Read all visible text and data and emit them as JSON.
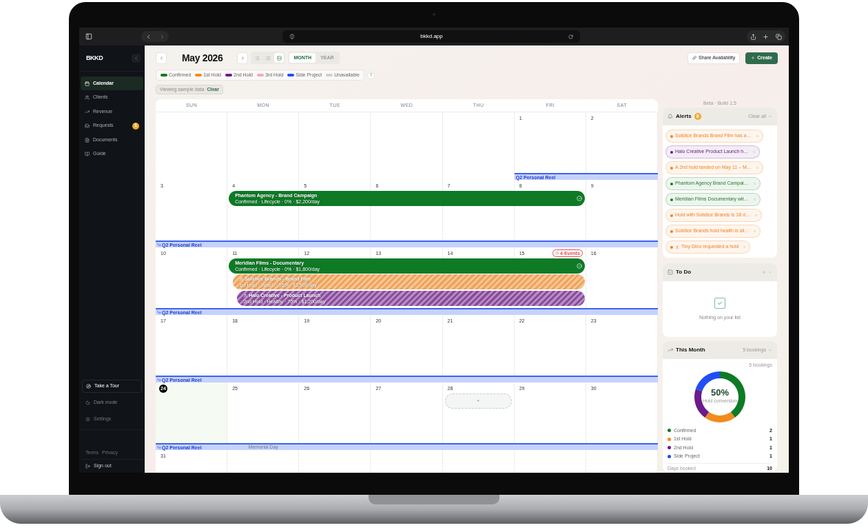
{
  "browser": {
    "url": "bkkd.app"
  },
  "sidebar": {
    "logo": "BKKD",
    "items": [
      {
        "label": "Calendar",
        "selected": true
      },
      {
        "label": "Clients",
        "selected": false
      },
      {
        "label": "Revenue",
        "selected": false
      },
      {
        "label": "Requests",
        "selected": false,
        "badge": "1"
      },
      {
        "label": "Documents",
        "selected": false
      },
      {
        "label": "Guide",
        "selected": false
      }
    ],
    "footer_items": [
      {
        "label": "Take a Tour",
        "kind": "tour"
      },
      {
        "label": "Dark mode",
        "kind": "toggle"
      },
      {
        "label": "Settings",
        "kind": "settings"
      }
    ],
    "links": [
      "Terms",
      "Privacy"
    ],
    "sign_out": "Sign out"
  },
  "header": {
    "month": "May 2026",
    "view_modes": [
      {
        "kind": "list",
        "selected": false
      },
      {
        "kind": "compact",
        "selected": false
      },
      {
        "kind": "month",
        "selected": true
      }
    ],
    "range_tabs": [
      {
        "label": "MONTH",
        "selected": true
      },
      {
        "label": "YEAR",
        "selected": false
      }
    ],
    "share_button": "Share Availability",
    "create_button": "Create"
  },
  "legend": {
    "items": [
      {
        "label": "Confirmed",
        "color": "#0e7a26"
      },
      {
        "label": "1st Hold",
        "color": "#f28a1e"
      },
      {
        "label": "2nd Hold",
        "color": "#6c1a8c"
      },
      {
        "label": "3rd Hold",
        "color": "#f5a7c7"
      },
      {
        "label": "Side Project",
        "color": "#1f4ff5"
      },
      {
        "label": "Unavailable",
        "color": "#cfcfcf"
      }
    ],
    "help": "?"
  },
  "sample_notice": {
    "text": "Viewing sample data",
    "action": "Clear"
  },
  "calendar": {
    "weekdays": [
      "SUN",
      "MON",
      "TUE",
      "WED",
      "THU",
      "FRI",
      "SAT"
    ],
    "weeks": [
      {
        "days": [
          {
            "kind": "blank"
          },
          {
            "kind": "blank"
          },
          {
            "kind": "blank"
          },
          {
            "kind": "blank"
          },
          {
            "kind": "blank"
          },
          {
            "kind": "date",
            "date": "1",
            "today": false
          },
          {
            "kind": "date",
            "date": "2",
            "today": false
          }
        ],
        "strip": [
          {
            "kind": "none"
          },
          {
            "kind": "none"
          },
          {
            "kind": "none"
          },
          {
            "kind": "none"
          },
          {
            "kind": "none"
          },
          {
            "kind": "start",
            "label": "Q2 Personal Reel"
          },
          {
            "kind": "more"
          }
        ]
      },
      {
        "days": [
          {
            "kind": "date",
            "date": "3",
            "today": false
          },
          {
            "kind": "date",
            "date": "4",
            "today": false
          },
          {
            "kind": "date",
            "date": "5",
            "today": false
          },
          {
            "kind": "date",
            "date": "6",
            "today": false
          },
          {
            "kind": "date",
            "date": "7",
            "today": false
          },
          {
            "kind": "date",
            "date": "8",
            "today": false
          },
          {
            "kind": "date",
            "date": "9",
            "today": false
          }
        ],
        "lanes": [
          [
            {
              "kind": "empty"
            },
            {
              "kind": "confirmed",
              "title": "Phantom Agency - Brand Campaign",
              "detail": "Confirmed · Lifecycle · 0% · $2,200/day"
            },
            {
              "kind": "more"
            },
            {
              "kind": "more"
            },
            {
              "kind": "more"
            },
            {
              "kind": "more"
            },
            {
              "kind": "empty"
            }
          ]
        ],
        "strip": [
          {
            "kind": "carried",
            "label": "Q2 Personal Reel"
          },
          {
            "kind": "more"
          },
          {
            "kind": "more"
          },
          {
            "kind": "more"
          },
          {
            "kind": "more"
          },
          {
            "kind": "more"
          },
          {
            "kind": "more"
          }
        ]
      },
      {
        "days": [
          {
            "kind": "date",
            "date": "10",
            "today": false
          },
          {
            "kind": "date",
            "date": "11",
            "today": false
          },
          {
            "kind": "date",
            "date": "12",
            "today": false
          },
          {
            "kind": "date",
            "date": "13",
            "today": false
          },
          {
            "kind": "date",
            "date": "14",
            "today": false
          },
          {
            "kind": "date",
            "date": "15",
            "today": false,
            "badge": "4 Events"
          },
          {
            "kind": "date",
            "date": "16",
            "today": false
          }
        ],
        "lanes": [
          [
            {
              "kind": "empty"
            },
            {
              "kind": "confirmed",
              "title": "Meridian Films - Documentary",
              "detail": "Confirmed · Lifecycle · 0% · $1,800/day"
            },
            {
              "kind": "more"
            },
            {
              "kind": "more"
            },
            {
              "kind": "more"
            },
            {
              "kind": "more"
            },
            {
              "kind": "empty"
            }
          ],
          [
            {
              "kind": "empty"
            },
            {
              "kind": "hold1",
              "title": "Solstice Brands - Brand Film",
              "detail": "1st Hold · Watch · 55% · $1,500/day"
            },
            {
              "kind": "more"
            },
            {
              "kind": "more"
            },
            {
              "kind": "more"
            },
            {
              "kind": "more"
            },
            {
              "kind": "empty"
            }
          ],
          [
            {
              "kind": "empty"
            },
            {
              "kind": "hold2",
              "title": "Halo Creative - Product Launch",
              "detail": "2nd Hold · Healthy · 75% · $1,200/day"
            },
            {
              "kind": "more"
            },
            {
              "kind": "more"
            },
            {
              "kind": "more"
            },
            {
              "kind": "more"
            },
            {
              "kind": "empty"
            }
          ]
        ],
        "strip": [
          {
            "kind": "carried",
            "label": "Q2 Personal Reel"
          },
          {
            "kind": "more"
          },
          {
            "kind": "more"
          },
          {
            "kind": "more"
          },
          {
            "kind": "more"
          },
          {
            "kind": "more"
          },
          {
            "kind": "more"
          }
        ]
      },
      {
        "days": [
          {
            "kind": "date",
            "date": "17",
            "today": false
          },
          {
            "kind": "date",
            "date": "18",
            "today": false
          },
          {
            "kind": "date",
            "date": "19",
            "today": false
          },
          {
            "kind": "date",
            "date": "20",
            "today": false
          },
          {
            "kind": "date",
            "date": "21",
            "today": false
          },
          {
            "kind": "date",
            "date": "22",
            "today": false
          },
          {
            "kind": "date",
            "date": "23",
            "today": false
          }
        ],
        "strip": [
          {
            "kind": "carried",
            "label": "Q2 Personal Reel"
          },
          {
            "kind": "more"
          },
          {
            "kind": "more"
          },
          {
            "kind": "more"
          },
          {
            "kind": "more"
          },
          {
            "kind": "more"
          },
          {
            "kind": "more"
          }
        ]
      },
      {
        "days": [
          {
            "kind": "date",
            "date": "24",
            "today": true
          },
          {
            "kind": "date",
            "date": "25",
            "today": false,
            "holiday": "Memorial Day"
          },
          {
            "kind": "date",
            "date": "26",
            "today": false
          },
          {
            "kind": "date",
            "date": "27",
            "today": false
          },
          {
            "kind": "date",
            "date": "28",
            "today": false,
            "add_label": "+"
          },
          {
            "kind": "date",
            "date": "29",
            "today": false
          },
          {
            "kind": "date",
            "date": "30",
            "today": false
          }
        ],
        "strip": [
          {
            "kind": "carried",
            "label": "Q2 Personal Reel"
          },
          {
            "kind": "more"
          },
          {
            "kind": "more"
          },
          {
            "kind": "more"
          },
          {
            "kind": "more"
          },
          {
            "kind": "more"
          },
          {
            "kind": "more"
          }
        ]
      },
      {
        "days": [
          {
            "kind": "date",
            "date": "31",
            "today": false
          },
          {
            "kind": "blank"
          },
          {
            "kind": "blank"
          },
          {
            "kind": "blank"
          },
          {
            "kind": "blank"
          },
          {
            "kind": "blank"
          },
          {
            "kind": "blank"
          }
        ]
      }
    ]
  },
  "panel": {
    "build": "Beta · Build 1.5",
    "alerts": {
      "title": "Alerts",
      "count": "8",
      "action": "Clear all",
      "items": [
        {
          "text": "Solstice Brands Brand Film has a…",
          "color": "#f07f1a",
          "kind": "notice"
        },
        {
          "text": "Halo Creative Product Launch h…",
          "color": "#6a1b84",
          "kind": "notice"
        },
        {
          "text": "A 2nd hold landed on May 11 – M…",
          "color": "#f07f1a",
          "kind": "notice"
        },
        {
          "text": "Phantom Agency Brand Campai…",
          "color": "#1c7a2c",
          "kind": "notice"
        },
        {
          "text": "Meridian Films Documentary wit…",
          "color": "#1c7a2c",
          "kind": "notice"
        },
        {
          "text": "Hold with Solstice Brands is 18 d…",
          "color": "#f07f1a",
          "kind": "notice"
        },
        {
          "text": "Solstice Brands hold health is sli…",
          "color": "#f07f1a",
          "kind": "notice"
        },
        {
          "text": "Tiny Dino requested a hold",
          "color": "#f07f1a",
          "kind": "request"
        }
      ]
    },
    "todo": {
      "title": "To Do",
      "empty": "Nothing on your list"
    },
    "month": {
      "title": "This Month",
      "filter": "5 bookings",
      "total": "5 bookings",
      "center_value": "50%",
      "center_label": "Hold conversion",
      "chart_data": {
        "type": "donut",
        "categories": [
          "Confirmed",
          "1st Hold",
          "2nd Hold",
          "Side Project"
        ],
        "values": [
          2,
          1,
          1,
          1
        ]
      },
      "legend": [
        {
          "color": "#0e7a26",
          "count": "2"
        },
        {
          "color": "#f28a1e",
          "count": "1"
        },
        {
          "color": "#6c1a8c",
          "count": "1"
        },
        {
          "color": "#1f4ff5",
          "count": "1"
        }
      ],
      "footer": {
        "label": "Days booked",
        "value": "10"
      }
    }
  }
}
